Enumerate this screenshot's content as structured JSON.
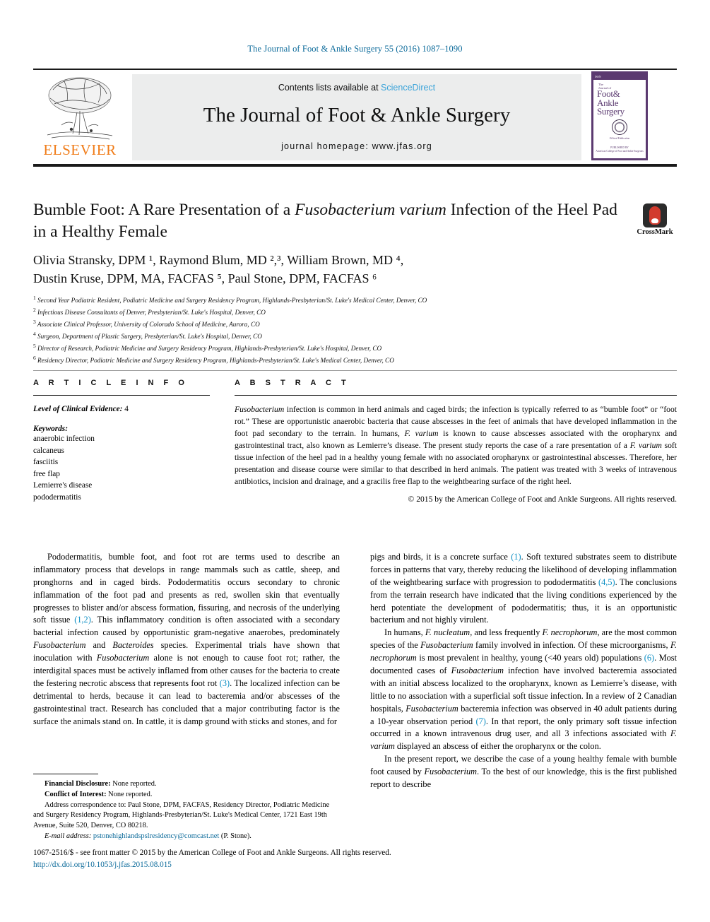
{
  "running_head": "The Journal of Foot & Ankle Surgery 55 (2016) 1087–1090",
  "masthead": {
    "publisher": "ELSEVIER",
    "contents_prefix": "Contents lists available at ",
    "sciencedirect": "ScienceDirect",
    "journal_title": "The Journal of Foot & Ankle Surgery",
    "homepage": "journal homepage: www.jfas.org",
    "cover": {
      "top_label": "ISSN",
      "pre1": "The",
      "pre2": "Journal of",
      "line1": "Foot&",
      "line2": "Ankle",
      "line3": "Surgery",
      "seal_caption": "Official Publication",
      "footer": "PUBLISHED BY",
      "footer2": "American College of Foot and Ankle Surgeons"
    }
  },
  "article": {
    "title_part1": "Bumble Foot: A Rare Presentation of a ",
    "title_italic": "Fusobacterium varium",
    "title_part2": " Infection of the Heel Pad in a Healthy Female",
    "crossmark_label": "CrossMark",
    "authors_line1": "Olivia Stransky, DPM ¹, Raymond Blum, MD ²,³, William Brown, MD ⁴,",
    "authors_line2": "Dustin Kruse, DPM, MA, FACFAS ⁵, Paul Stone, DPM, FACFAS ⁶",
    "affiliations": [
      "Second Year Podiatric Resident, Podiatric Medicine and Surgery Residency Program, Highlands-Presbyterian/St. Luke's Medical Center, Denver, CO",
      "Infectious Disease Consultants of Denver, Presbyterian/St. Luke's Hospital, Denver, CO",
      "Associate Clinical Professor, University of Colorado School of Medicine, Aurora, CO",
      "Surgeon, Department of Plastic Surgery, Presbyterian/St. Luke's Hospital, Denver, CO",
      "Director of Research, Podiatric Medicine and Surgery Residency Program, Highlands-Presbyterian/St. Luke's Hospital, Denver, CO",
      "Residency Director, Podiatric Medicine and Surgery Residency Program, Highlands-Presbyterian/St. Luke's Medical Center, Denver, CO"
    ]
  },
  "article_info": {
    "heading": "A R T I C L E  I N F O",
    "evidence_label": "Level of Clinical Evidence:",
    "evidence_value": "4",
    "keywords_label": "Keywords:",
    "keywords": [
      "anaerobic infection",
      "calcaneus",
      "fasciitis",
      "free flap",
      "Lemierre's disease",
      "pododermatitis"
    ]
  },
  "abstract": {
    "heading": "A B S T R A C T",
    "copyright": "© 2015 by the American College of Foot and Ankle Surgeons. All rights reserved."
  },
  "footnotes": {
    "financial_label": "Financial Disclosure:",
    "financial_value": " None reported.",
    "conflict_label": "Conflict of Interest:",
    "conflict_value": " None reported.",
    "address_label": "Address correspondence to:",
    "address_value": " Paul Stone, DPM, FACFAS, Residency Director, Podiatric Medicine and Surgery Residency Program, Highlands-Presbyterian/St. Luke's Medical Center, 1721 East 19th Avenue, Suite 520, Denver, CO 80218.",
    "email_label": "E-mail address:",
    "email_value": "pstonehighlandspslresidency@comcast.net",
    "email_suffix": " (P. Stone)."
  },
  "footer": {
    "frontmatter": "1067-2516/$ - see front matter © 2015 by the American College of Foot and Ankle Surgeons. All rights reserved.",
    "doi": "http://dx.doi.org/10.1053/j.jfas.2015.08.015"
  },
  "colors": {
    "link_blue": "#0b6a9a",
    "citation_blue": "#0b8ec4",
    "elsevier_orange": "#f07d1a",
    "cover_purple": "#5b3a70"
  }
}
